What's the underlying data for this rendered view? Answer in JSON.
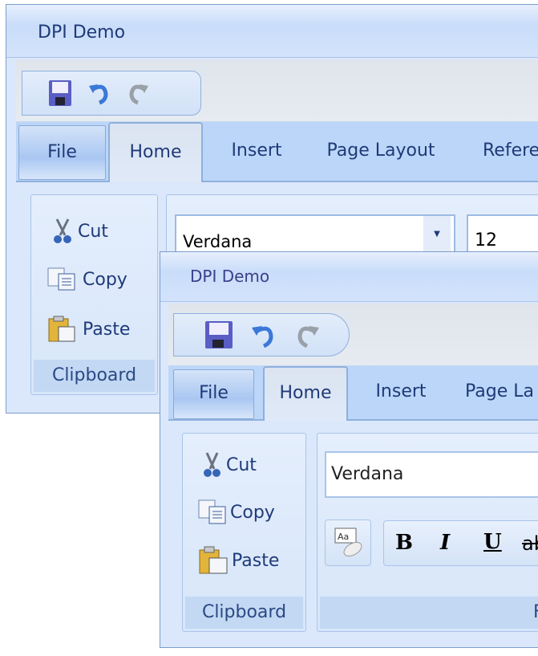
{
  "windows": [
    {
      "title": "DPI Demo",
      "qat": {
        "icons": [
          "save-icon",
          "undo-icon",
          "redo-icon"
        ]
      },
      "tabs": [
        "File",
        "Home",
        "Insert",
        "Page Layout",
        "Refere"
      ],
      "active_tab": "Home",
      "clipboard": {
        "items": [
          "Cut",
          "Copy",
          "Paste"
        ],
        "label": "Clipboard"
      },
      "font": {
        "family": "Verdana",
        "size": "12"
      }
    },
    {
      "title": "DPI Demo",
      "qat": {
        "icons": [
          "save-icon",
          "undo-icon",
          "redo-icon"
        ]
      },
      "tabs": [
        "File",
        "Home",
        "Insert",
        "Page La"
      ],
      "active_tab": "Home",
      "clipboard": {
        "items": [
          "Cut",
          "Copy",
          "Paste"
        ],
        "label": "Clipboard"
      },
      "font": {
        "family": "Verdana",
        "buttons": [
          "B",
          "I",
          "U",
          "ab"
        ],
        "label": "F"
      }
    }
  ],
  "colors": {
    "title_text": "#1f3a78",
    "tab_bar": "#bcd6f9",
    "ribbon": "#dbe8fb"
  }
}
